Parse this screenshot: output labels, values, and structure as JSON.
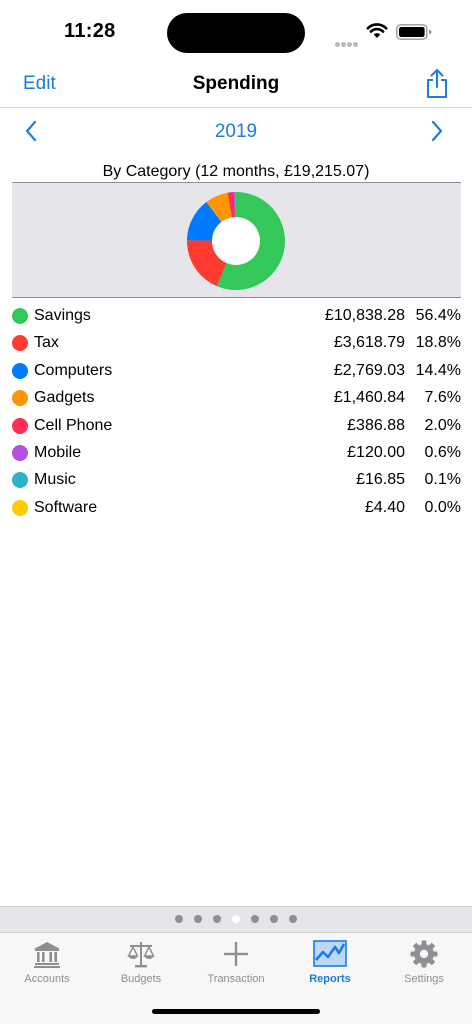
{
  "status_bar": {
    "time": "11:28"
  },
  "nav": {
    "edit_label": "Edit",
    "title": "Spending",
    "share_icon": "share-icon"
  },
  "year_selector": {
    "year": "2019",
    "prev_icon": "chevron-left-icon",
    "next_icon": "chevron-right-icon"
  },
  "chart_data": {
    "type": "pie",
    "title": "By Category (12 months, £19,215.07)",
    "donut": true,
    "categories": [
      "Savings",
      "Tax",
      "Computers",
      "Gadgets",
      "Cell Phone",
      "Mobile",
      "Music",
      "Software"
    ],
    "values": [
      10838.28,
      3618.79,
      2769.03,
      1460.84,
      386.88,
      120.0,
      16.85,
      4.4
    ],
    "amounts": [
      "£10,838.28",
      "£3,618.79",
      "£2,769.03",
      "£1,460.84",
      "£386.88",
      "£120.00",
      "£16.85",
      "£4.40"
    ],
    "percents": [
      "56.4%",
      "18.8%",
      "14.4%",
      "7.6%",
      "2.0%",
      "0.6%",
      "0.1%",
      "0.0%"
    ],
    "colors": [
      "#34c759",
      "#ff3b30",
      "#007aff",
      "#ff9500",
      "#ff2d55",
      "#af52de",
      "#30b0c7",
      "#ffcc00"
    ],
    "legend": "below"
  },
  "page_indicator": {
    "count": 7,
    "active_index": 3
  },
  "tab_bar": {
    "items": [
      {
        "label": "Accounts",
        "icon": "bank-icon",
        "active": false
      },
      {
        "label": "Budgets",
        "icon": "scales-icon",
        "active": false
      },
      {
        "label": "Transaction",
        "icon": "plus-icon",
        "active": false
      },
      {
        "label": "Reports",
        "icon": "chart-icon",
        "active": true
      },
      {
        "label": "Settings",
        "icon": "gear-icon",
        "active": false
      }
    ]
  },
  "colors": {
    "accent": "#1c7ce0",
    "inactive": "#8e8e93"
  }
}
